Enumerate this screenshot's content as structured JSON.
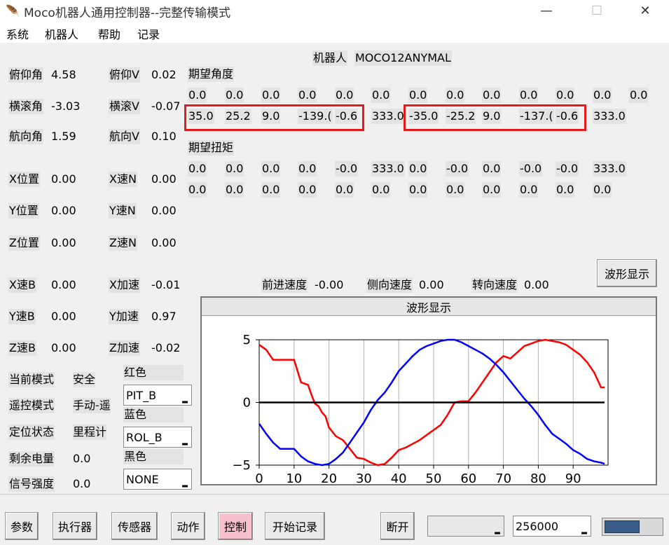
{
  "window": {
    "title": "Moco机器人通用控制器--完整传输模式",
    "minimize": "—",
    "maximize": "☐",
    "close": "✕"
  },
  "menu": [
    "系统",
    "机器人",
    "帮助",
    "记录"
  ],
  "robot": {
    "label": "机器人",
    "name": "MOCO12ANYMAL"
  },
  "left_col1": [
    {
      "label": "俯仰角",
      "value": "4.58"
    },
    {
      "label": "横滚角",
      "value": "-3.03"
    },
    {
      "label": "航向角",
      "value": "1.59"
    },
    {
      "label": "X位置",
      "value": "0.00"
    },
    {
      "label": "Y位置",
      "value": "0.00"
    },
    {
      "label": "Z位置",
      "value": "0.00"
    },
    {
      "label": "X速B",
      "value": "0.00"
    },
    {
      "label": "Y速B",
      "value": "0.00"
    },
    {
      "label": "Z速B",
      "value": "0.00"
    }
  ],
  "left_col2": [
    {
      "label": "俯仰V",
      "value": "0.02"
    },
    {
      "label": "横滚V",
      "value": "-0.07"
    },
    {
      "label": "航向V",
      "value": "0.10"
    },
    {
      "label": "X速N",
      "value": "0.00"
    },
    {
      "label": "Y速N",
      "value": "0.00"
    },
    {
      "label": "Z速N",
      "value": "0.00"
    },
    {
      "label": "X加速",
      "value": "-0.01"
    },
    {
      "label": "Y加速",
      "value": "0.97"
    },
    {
      "label": "Z加速",
      "value": "-0.02"
    }
  ],
  "status": [
    {
      "label": "当前模式",
      "value": "安全"
    },
    {
      "label": "遥控模式",
      "value": "手动-遥"
    },
    {
      "label": "定位状态",
      "value": "里程计"
    },
    {
      "label": "剩余电量",
      "value": "0.0"
    },
    {
      "label": "信号强度",
      "value": "0.0"
    }
  ],
  "color_selectors": [
    {
      "label": "红色",
      "value": "PIT_B"
    },
    {
      "label": "蓝色",
      "value": "ROL_B"
    },
    {
      "label": "黑色",
      "value": "NONE"
    }
  ],
  "expected_angle": {
    "title": "期望角度",
    "row1": [
      "0.0",
      "0.0",
      "0.0",
      "0.0",
      "0.0",
      "0.0",
      "0.0",
      "0.0",
      "0.0",
      "0.0",
      "0.0",
      "0.0",
      "0.0"
    ],
    "row2": [
      "35.0",
      "25.2",
      "9.0",
      "-139.(",
      "-0.6",
      "333.0",
      "-35.0",
      "-25.2",
      "9.0",
      "-137.(",
      "-0.6",
      "333.0"
    ]
  },
  "expected_torque": {
    "title": "期望扭矩",
    "row1": [
      "0.0",
      "0.0",
      "0.0",
      "0.0",
      "-0.0",
      "333.0",
      "0.0",
      "-0.0",
      "0.0",
      "-0.0",
      "-0.0",
      "333.0"
    ],
    "row2": [
      "0.0",
      "0.0",
      "0.0",
      "0.0",
      "0.0",
      "0.0",
      "0.0",
      "0.0",
      "0.0",
      "0.0",
      "0.0",
      "0.0"
    ]
  },
  "speeds": [
    {
      "label": "前进速度",
      "value": "-0.00"
    },
    {
      "label": "侧向速度",
      "value": "0.00"
    },
    {
      "label": "转向速度",
      "value": "0.00"
    }
  ],
  "waveform_button": "波形显示",
  "plot": {
    "title": "波形显示",
    "colors": {
      "red": "#ff0000",
      "blue": "#0000ff",
      "black": "#000000"
    }
  },
  "chart_data": {
    "type": "line",
    "xlim": [
      0,
      100
    ],
    "ylim": [
      -5,
      5
    ],
    "x_ticks": [
      "0",
      "10",
      "20",
      "30",
      "40",
      "50",
      "60",
      "70",
      "80",
      "90"
    ],
    "y_ticks": [
      "5",
      "0",
      "−5"
    ],
    "series": [
      {
        "color": "red",
        "x": [
          0,
          2,
          4,
          10,
          11,
          12,
          14,
          15,
          16,
          17,
          18,
          19,
          20,
          22,
          24,
          26,
          28,
          30,
          32,
          34,
          36,
          38,
          40,
          42,
          44,
          46,
          48,
          50,
          52,
          54,
          56,
          58,
          60,
          62,
          64,
          66,
          68,
          70,
          72,
          74,
          76,
          78,
          80,
          82,
          84,
          86,
          88,
          90,
          92,
          94,
          96,
          98,
          99
        ],
        "y": [
          4.6,
          4.2,
          3.4,
          3.4,
          2.5,
          1.6,
          1.4,
          0.6,
          -0.1,
          -0.3,
          -0.8,
          -1.1,
          -2.0,
          -2.7,
          -3.0,
          -3.7,
          -4.4,
          -4.5,
          -4.8,
          -5.0,
          -4.9,
          -4.4,
          -3.8,
          -3.6,
          -3.3,
          -3.0,
          -2.6,
          -2.2,
          -1.8,
          -1.0,
          0.0,
          0.1,
          0.1,
          0.8,
          1.6,
          2.4,
          3.2,
          3.7,
          3.5,
          4.0,
          4.5,
          4.7,
          4.9,
          5.0,
          4.9,
          4.8,
          4.6,
          4.2,
          3.8,
          3.2,
          2.4,
          1.2,
          1.2
        ]
      },
      {
        "color": "blue",
        "x": [
          0,
          2,
          4,
          6,
          8,
          10,
          12,
          14,
          16,
          18,
          20,
          22,
          24,
          26,
          28,
          30,
          32,
          34,
          36,
          38,
          40,
          42,
          44,
          46,
          48,
          50,
          52,
          54,
          56,
          58,
          60,
          62,
          64,
          66,
          68,
          70,
          72,
          74,
          76,
          78,
          80,
          82,
          84,
          86,
          88,
          90,
          92,
          94,
          96,
          98,
          99
        ],
        "y": [
          -1.7,
          -2.5,
          -3.2,
          -3.7,
          -3.7,
          -3.7,
          -4.3,
          -4.7,
          -4.9,
          -5.0,
          -4.9,
          -4.5,
          -4.0,
          -3.2,
          -2.4,
          -1.6,
          -0.6,
          0.2,
          0.8,
          1.6,
          2.5,
          3.1,
          3.7,
          4.2,
          4.5,
          4.7,
          4.9,
          5.0,
          5.0,
          4.8,
          4.5,
          4.2,
          3.9,
          3.5,
          3.0,
          2.4,
          1.7,
          1.0,
          0.3,
          -0.3,
          -1.0,
          -1.8,
          -2.5,
          -2.9,
          -3.3,
          -3.8,
          -4.1,
          -4.5,
          -4.7,
          -4.8,
          -4.9
        ]
      },
      {
        "color": "black",
        "x": [
          0,
          99
        ],
        "y": [
          0,
          0
        ]
      }
    ]
  },
  "bottom_buttons": [
    "参数",
    "执行器",
    "传感器",
    "动作",
    "控制",
    "开始记录",
    "断开"
  ],
  "baud": "256000",
  "port": ""
}
